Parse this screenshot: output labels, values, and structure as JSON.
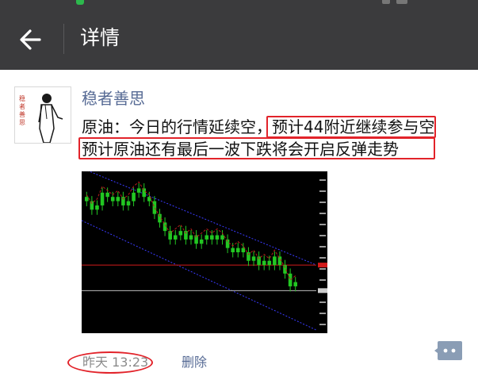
{
  "nav": {
    "title": "详情",
    "back_icon": "back-arrow-icon"
  },
  "post": {
    "author": "稳者善思",
    "avatar_text": "稳者善思",
    "text_line1": "原油：今日的行情延续空，预计44附近继续参与空",
    "text_line2": "预计原油还有最后一波下跌将会开启反弹走势",
    "timestamp": "昨天 13:23",
    "delete_label": "删除"
  },
  "colors": {
    "navbar_bg": "#3b3b3d",
    "link": "#576b95",
    "highlight_red": "#e2232a",
    "candle_green": "#22c722",
    "channel_blue": "#3a3aff"
  },
  "icons": {
    "comment": "comment-bubble-icon"
  },
  "chart_data": {
    "type": "candlestick",
    "description_series": [
      {
        "name": "",
        "close": [
          45.7,
          45.5,
          45.6,
          45.9,
          45.8,
          45.7,
          45.8,
          45.6,
          45.7,
          45.9,
          46.0,
          45.8,
          45.7,
          45.4,
          45.2,
          45.0,
          44.8,
          44.9,
          45.0,
          44.8,
          44.9,
          44.7,
          44.8,
          44.9,
          44.8,
          44.9,
          44.8,
          44.6,
          44.5,
          44.6,
          44.5,
          44.3,
          44.4,
          44.2,
          44.3,
          44.2,
          44.4,
          44.2,
          44.0,
          43.7,
          43.8
        ]
      }
    ],
    "horizontal_lines": [
      44.2,
      43.6
    ],
    "channel": "descending",
    "ylim": [
      42.6,
      46.4
    ]
  }
}
